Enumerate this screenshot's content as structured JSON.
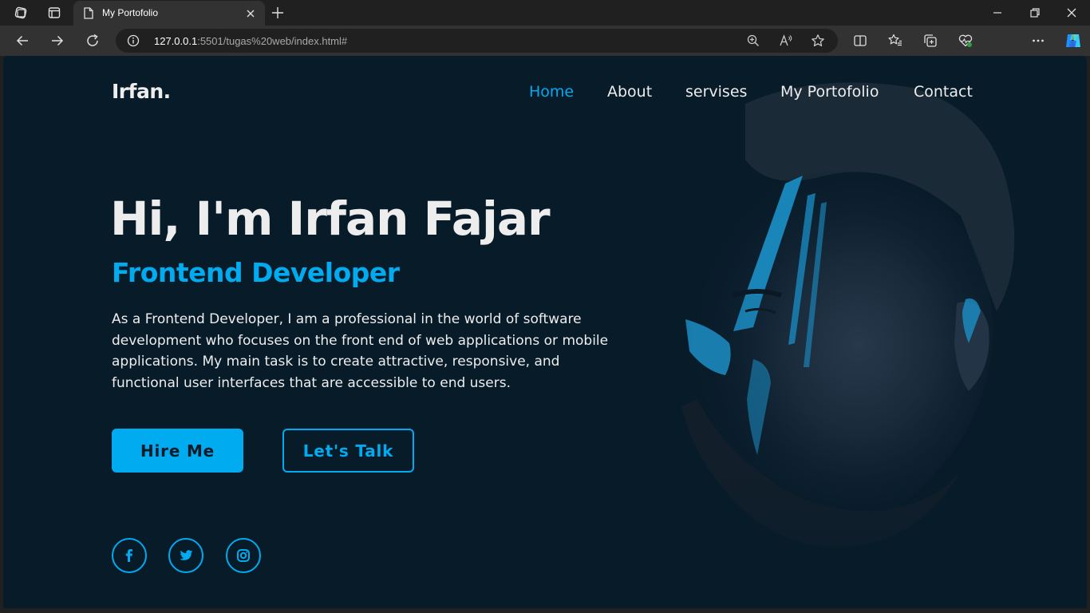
{
  "browser": {
    "tab_title": "My Portofolio",
    "url_host": "127.0.0.1",
    "url_rest": ":5501/tugas%20web/index.html#"
  },
  "page": {
    "logo": "Irfan.",
    "nav": [
      {
        "label": "Home",
        "active": true
      },
      {
        "label": "About",
        "active": false
      },
      {
        "label": "servises",
        "active": false
      },
      {
        "label": "My Portofolio",
        "active": false
      },
      {
        "label": "Contact",
        "active": false
      }
    ],
    "heading": "Hi, I'm Irfan Fajar",
    "role": "Frontend Developer",
    "description": "As a Frontend Developer, I am a professional in the world of software development who focuses on the front end of web applications or mobile applications. My main task is to create attractive, responsive, and functional user interfaces that are accessible to end users.",
    "buttons": {
      "primary": "Hire Me",
      "secondary": "Let's Talk"
    },
    "social_icons": [
      "facebook-icon",
      "twitter-icon",
      "instagram-icon"
    ]
  },
  "colors": {
    "background": "#081b29",
    "accent": "#00abf0",
    "text": "#ededed"
  }
}
